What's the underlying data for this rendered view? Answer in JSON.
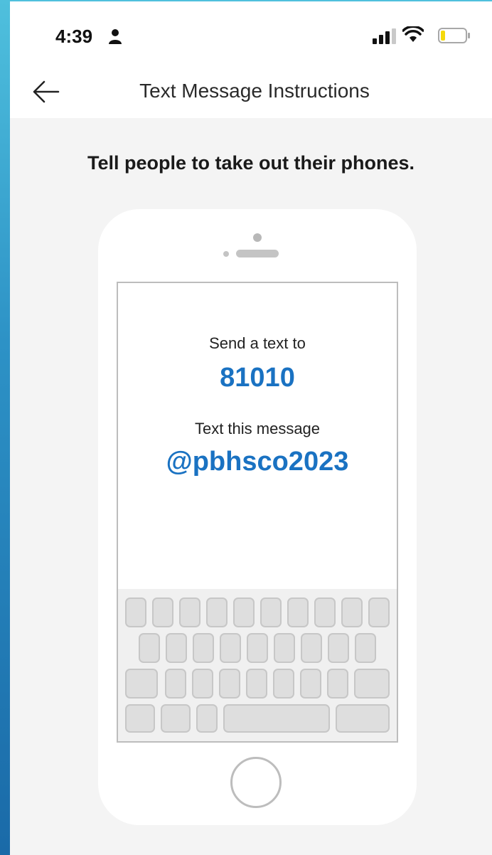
{
  "status_bar": {
    "time": "4:39"
  },
  "nav": {
    "title": "Text Message Instructions"
  },
  "main": {
    "headline": "Tell people to take out their phones.",
    "send_label": "Send a text to",
    "number": "81010",
    "message_label": "Text this message",
    "message_code": "@pbhsco2023"
  },
  "colors": {
    "accent": "#1a72c2",
    "battery_level": "#f5d90a"
  },
  "icons": [
    "person-icon",
    "signal-icon",
    "wifi-icon",
    "battery-icon",
    "back-arrow-icon",
    "home-button-icon"
  ]
}
